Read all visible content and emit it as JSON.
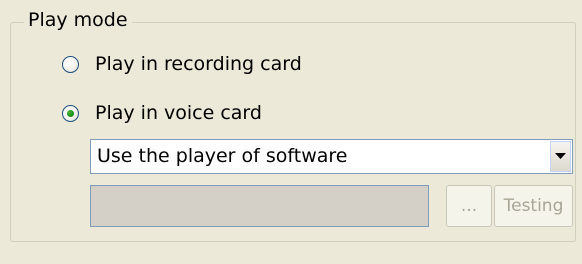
{
  "play_mode": {
    "group_title": "Play mode",
    "options": [
      {
        "label": "Play in recording card",
        "selected": false
      },
      {
        "label": "Play in voice card",
        "selected": true
      }
    ],
    "player_select": {
      "value": "Use the player of software"
    },
    "path_field": {
      "value": "",
      "enabled": false
    },
    "browse_button": {
      "label": "...",
      "enabled": false
    },
    "testing_button": {
      "label": "Testing",
      "enabled": false
    }
  },
  "colors": {
    "window_bg": "#ECE9D8",
    "disabled_field_bg": "#D4D0C8",
    "disabled_text": "#A7A595",
    "radio_dot": "#21A121"
  },
  "icons": {
    "combo_arrow": "chevron-down-icon"
  }
}
